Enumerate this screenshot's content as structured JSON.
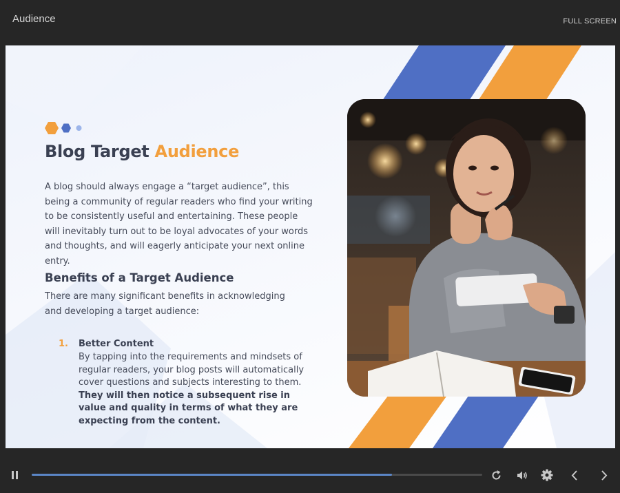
{
  "app": {
    "title": "Audience",
    "fullscreen_label": "FULL SCREEN"
  },
  "slide": {
    "title_main": "Blog Target",
    "title_accent": "Audience",
    "intro": "A blog should always engage a “target audience”, this being a community of regular readers who find your writing to be consistently useful and entertaining. These people will inevitably turn out to be loyal advocates of your words and thoughts, and will eagerly anticipate your next online entry.",
    "subheading": "Benefits of a Target Audience",
    "subintro": "There are many significant benefits in acknowledging and developing a target audience:",
    "list": [
      {
        "number": "1.",
        "heading": "Better Content",
        "text": "By tapping into the requirements and mindsets of regular readers, your blog posts will automatically cover questions and subjects interesting to them.",
        "bold_text": "They will then notice a subsequent rise in value and quality in terms of what they are expecting from the content."
      }
    ]
  },
  "colors": {
    "accent_orange": "#f29f3d",
    "accent_blue": "#4f6fc4",
    "heading": "#3a4052",
    "progress": "#5b86c6"
  },
  "player": {
    "progress_fraction": 0.8,
    "icons": [
      "pause-icon",
      "replay-icon",
      "volume-icon",
      "settings-icon",
      "prev-icon",
      "next-icon"
    ]
  }
}
